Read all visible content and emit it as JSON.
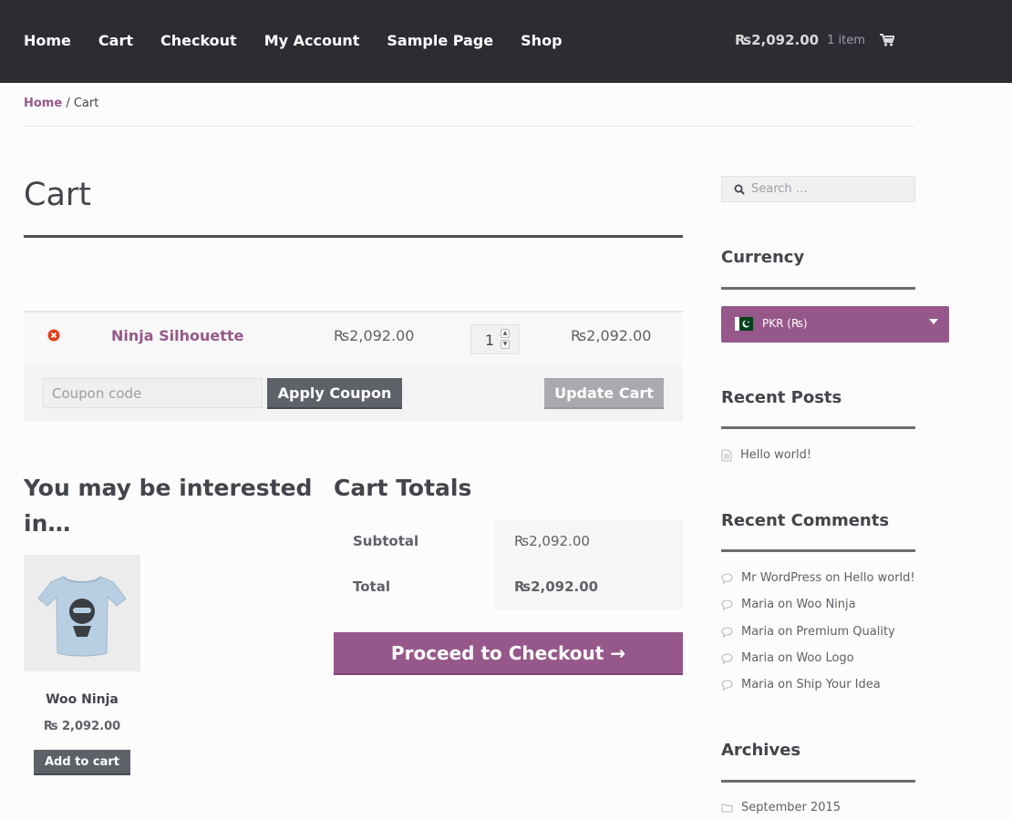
{
  "header": {
    "nav": [
      "Home",
      "Cart",
      "Checkout",
      "My Account",
      "Sample Page",
      "Shop"
    ],
    "mini_cart": {
      "amount": "₨2,092.00",
      "count": "1 item"
    }
  },
  "breadcrumb": {
    "home": "Home",
    "separator": "/",
    "current": "Cart"
  },
  "page_title": "Cart",
  "cart": {
    "item": {
      "name": "Ninja Silhouette",
      "price": "₨2,092.00",
      "quantity": "1",
      "subtotal": "₨2,092.00"
    },
    "coupon_placeholder": "Coupon code",
    "apply_coupon": "Apply Coupon",
    "update_cart": "Update Cart"
  },
  "cross_sells": {
    "title": "You may be interested in…",
    "product": {
      "name": "Woo Ninja",
      "price": "₨ 2,092.00",
      "button": "Add to cart"
    }
  },
  "totals": {
    "title": "Cart Totals",
    "rows": [
      {
        "label": "Subtotal",
        "value": "₨2,092.00"
      },
      {
        "label": "Total",
        "value": "₨2,092.00"
      }
    ],
    "checkout_button": "Proceed to Checkout →"
  },
  "sidebar": {
    "search_placeholder": "Search …",
    "currency": {
      "title": "Currency",
      "selected": "PKR (₨)"
    },
    "recent_posts": {
      "title": "Recent Posts",
      "items": [
        "Hello world!"
      ]
    },
    "recent_comments": {
      "title": "Recent Comments",
      "connector": "on",
      "items": [
        {
          "author": "Mr WordPress",
          "post": "Hello world!"
        },
        {
          "author": "Maria",
          "post": "Woo Ninja"
        },
        {
          "author": "Maria",
          "post": "Premium Quality"
        },
        {
          "author": "Maria",
          "post": "Woo Logo"
        },
        {
          "author": "Maria",
          "post": "Ship Your Idea"
        }
      ]
    },
    "archives": {
      "title": "Archives",
      "items": [
        "September 2015"
      ]
    }
  },
  "colors": {
    "header_bg": "#2c2d33",
    "accent": "#96588a",
    "button_dark": "#5e6168"
  }
}
